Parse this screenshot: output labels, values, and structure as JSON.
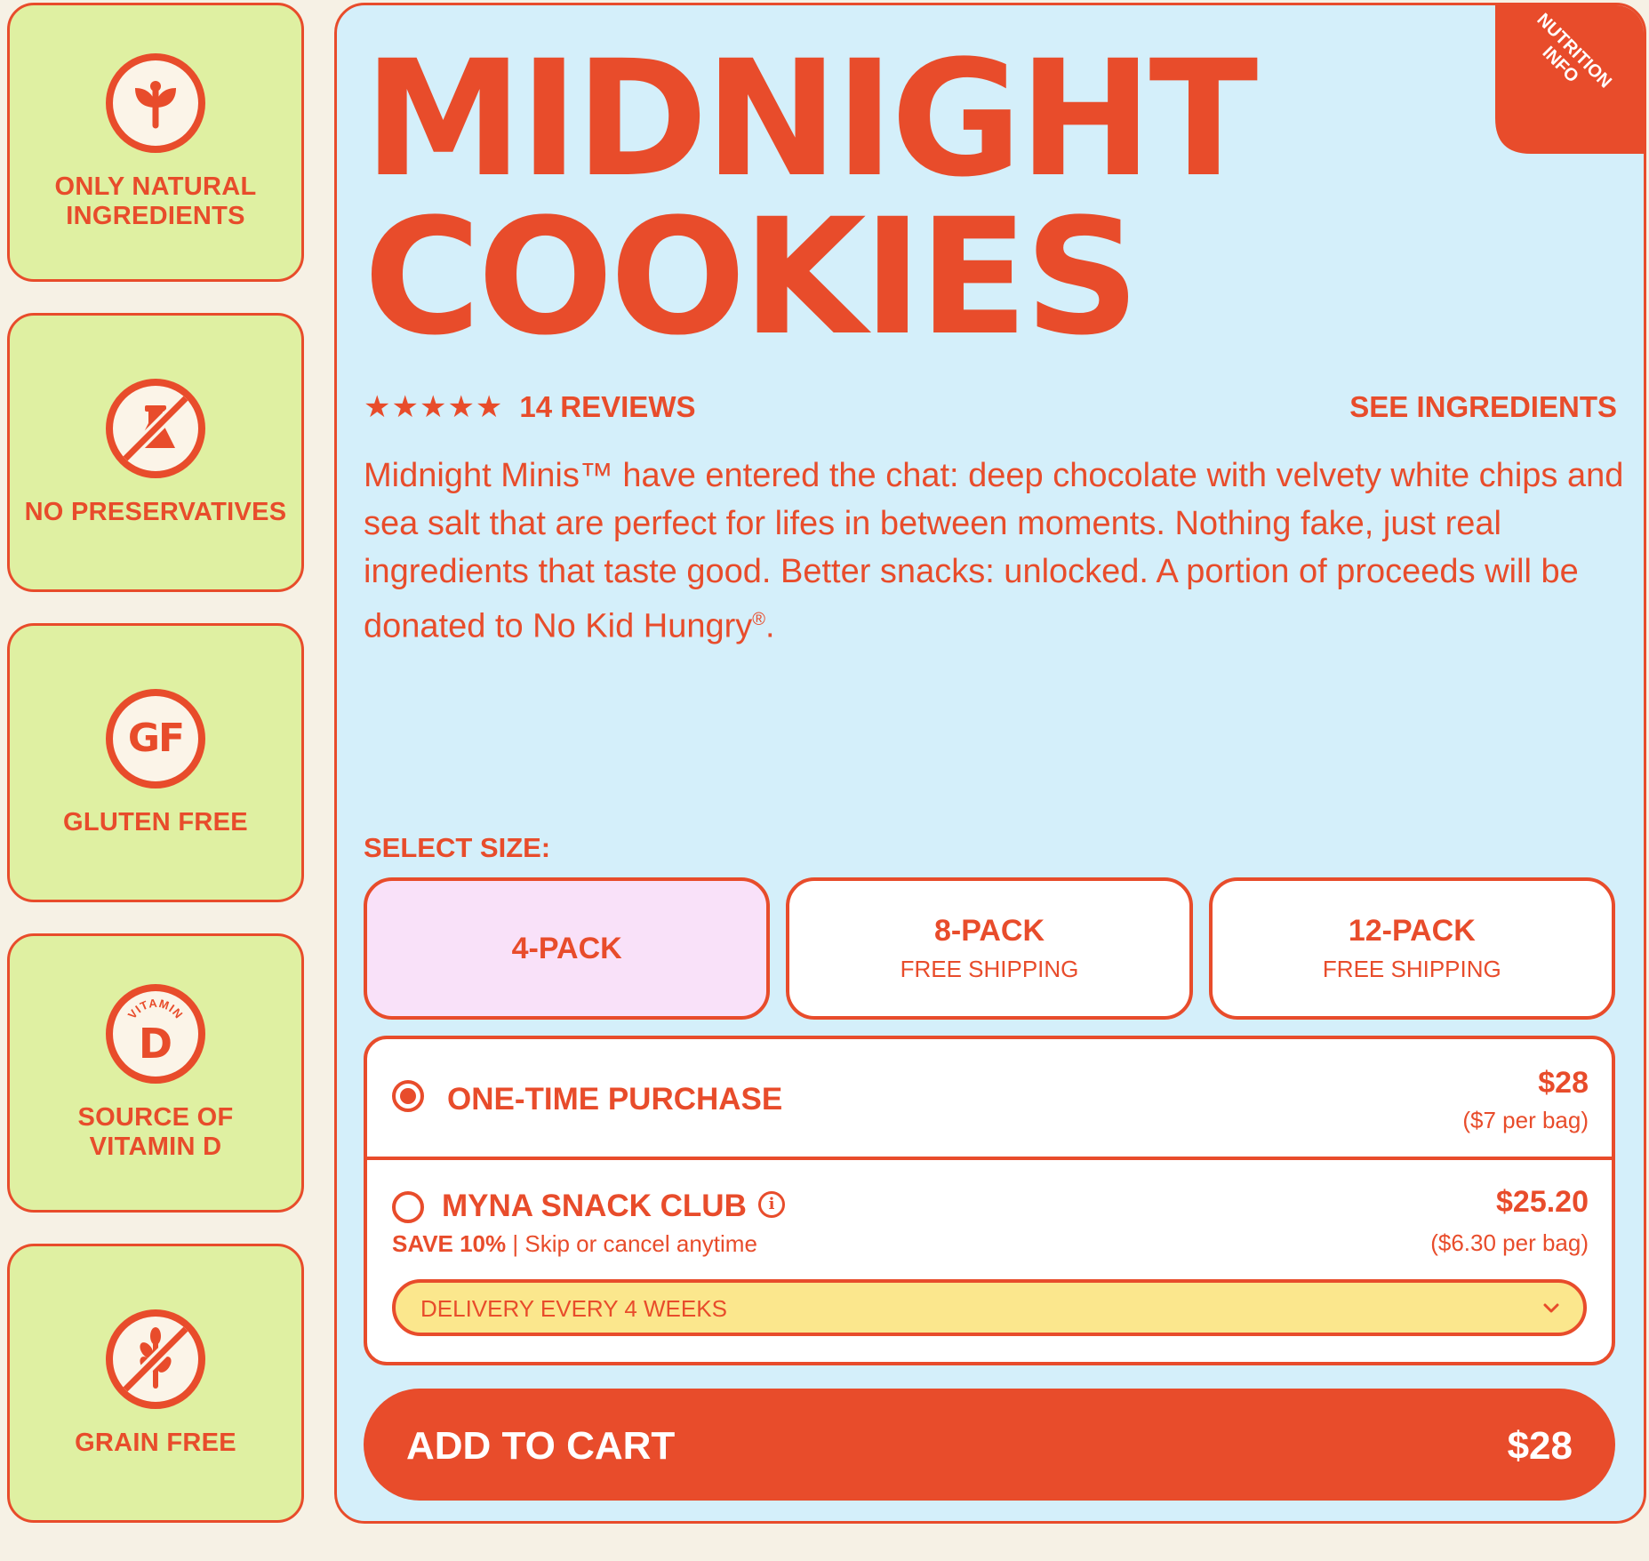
{
  "badges": [
    {
      "icon": "sprout-icon",
      "label": "ONLY NATURAL INGREDIENTS"
    },
    {
      "icon": "no-preservatives-icon",
      "label": "NO PRESERVATIVES"
    },
    {
      "icon": "gluten-free-icon",
      "icon_text": "GF",
      "label": "GLUTEN FREE"
    },
    {
      "icon": "vitamin-d-icon",
      "icon_text": "D",
      "icon_arc_text": "VITAMIN",
      "label": "SOURCE OF VITAMIN D"
    },
    {
      "icon": "grain-free-icon",
      "label": "GRAIN FREE"
    }
  ],
  "product": {
    "corner_tab": "NUTRITION INFO",
    "title_line1": "MIDNIGHT",
    "title_line2": "COOKIES",
    "stars": "★★★★★",
    "rating_stars": 5,
    "reviews": "14 REVIEWS",
    "see_ingredients": "SEE INGREDIENTS",
    "description": "Midnight Minis™ have entered the chat: deep chocolate with velvety white chips and sea salt that are perfect for lifes in between moments. Nothing fake, just real ingredients that taste good. Better snacks: unlocked. A portion of proceeds will be donated to No Kid Hungry",
    "description_mark": "®",
    "description_end": "."
  },
  "size": {
    "label": "SELECT SIZE:",
    "options": [
      {
        "name": "4-PACK",
        "sub": "",
        "selected": true
      },
      {
        "name": "8-PACK",
        "sub": "FREE SHIPPING",
        "selected": false
      },
      {
        "name": "12-PACK",
        "sub": "FREE SHIPPING",
        "selected": false
      }
    ]
  },
  "purchase": {
    "one_time": {
      "title": "ONE-TIME PURCHASE",
      "price": "$28",
      "per_bag": "($7 per bag)",
      "selected": true
    },
    "club": {
      "title": "MYNA SNACK CLUB",
      "save": "SAVE 10%",
      "note": "| Skip or cancel anytime",
      "price": "$25.20",
      "per_bag": "($6.30 per bag)",
      "selected": false,
      "delivery": "DELIVERY EVERY 4 WEEKS"
    }
  },
  "cart": {
    "label": "ADD TO CART",
    "price": "$28"
  },
  "colors": {
    "accent": "#e84c2b",
    "badge_bg": "#dff0a2",
    "panel_bg": "#d4effa",
    "page_bg": "#f6f1e5",
    "selected_size_bg": "#f9e1f9",
    "dropdown_bg": "#fbe78d"
  }
}
